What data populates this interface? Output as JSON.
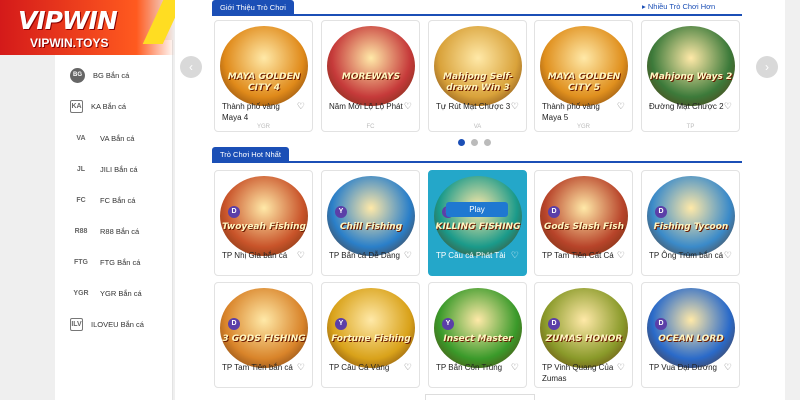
{
  "brand": {
    "name": "VIPWIN",
    "url": "VIPWIN.TOYS"
  },
  "sidebar": {
    "items": [
      {
        "logo": "BG",
        "label": "BG Bắn cá"
      },
      {
        "logo": "KA",
        "label": "KA Bắn cá"
      },
      {
        "logo": "VA",
        "label": "VA Bắn cá"
      },
      {
        "logo": "JL",
        "label": "JILI Bắn cá"
      },
      {
        "logo": "FC",
        "label": "FC Bắn cá"
      },
      {
        "logo": "R88",
        "label": "R88 Bắn cá"
      },
      {
        "logo": "FTG",
        "label": "FTG Bắn cá"
      },
      {
        "logo": "YGR",
        "label": "YGR Bắn cá"
      },
      {
        "logo": "ILV",
        "label": "ILOVEU Bắn cá"
      }
    ]
  },
  "intro_section": {
    "title": "Giới Thiệu Trò Chơi",
    "view_more": "Nhiều Trò Chơi Hơn",
    "games": [
      {
        "name": "Thành phố vàng Maya 4",
        "logo": "MAYA GOLDEN CITY 4",
        "provider": "YGR",
        "color": "#e08a1a"
      },
      {
        "name": "Năm Mới Lộ Lộ Phát",
        "logo": "MOREWAYS",
        "provider": "FC",
        "color": "#c63a3a"
      },
      {
        "name": "Tự Rút Mạt Chược 3",
        "logo": "Mahjong Self-drawn Win 3",
        "provider": "VA",
        "color": "#d9a23a"
      },
      {
        "name": "Thành phố vàng Maya 5",
        "logo": "MAYA GOLDEN CITY 5",
        "provider": "YGR",
        "color": "#e0901e"
      },
      {
        "name": "Đường Mạt Chược 2",
        "logo": "Mahjong Ways 2",
        "provider": "TP",
        "color": "#3c7a3a"
      }
    ],
    "dots": [
      true,
      false,
      false
    ]
  },
  "hot_section": {
    "title": "Trò Chơi Hot Nhất",
    "games": [
      {
        "name": "TP Nhị Gia bắn cá",
        "logo": "Twoyeah Fishing",
        "badge": "D",
        "color": "#c9542a",
        "active": false
      },
      {
        "name": "TP Bắn cá Dễ Dàng",
        "logo": "Chill Fishing",
        "badge": "Y",
        "color": "#2a7fc9",
        "active": false
      },
      {
        "name": "TP Câu cá Phát Tài",
        "logo": "KILLING FISHING",
        "badge": "D",
        "color": "#1a9a8a",
        "active": true,
        "play": "Play"
      },
      {
        "name": "TP Tam Tiên Cất Cá",
        "logo": "Gods Slash Fish",
        "badge": "D",
        "color": "#b8442a",
        "active": false
      },
      {
        "name": "TP Ông Trùm bắn cá",
        "logo": "Fishing Tycoon",
        "badge": "D",
        "color": "#3a8ac9",
        "active": false
      },
      {
        "name": "TP Tam Tiên bắn cá",
        "logo": "3 GODS FISHING",
        "badge": "D",
        "color": "#d9842a",
        "active": false
      },
      {
        "name": "TP Câu Cá Vàng",
        "logo": "Fortune Fishing",
        "badge": "Y",
        "color": "#d9a21a",
        "active": false
      },
      {
        "name": "TP Bắn Côn Trùng",
        "logo": "Insect Master",
        "badge": "Y",
        "color": "#3a9a2a",
        "active": false
      },
      {
        "name": "TP Vinh Quang Của Zumas",
        "logo": "ZUMAS HONOR",
        "badge": "D",
        "color": "#8a9a2a",
        "active": false
      },
      {
        "name": "TP Vua Đại Dương",
        "logo": "OCEAN LORD",
        "badge": "D",
        "color": "#2a6ac9",
        "active": false
      }
    ]
  }
}
